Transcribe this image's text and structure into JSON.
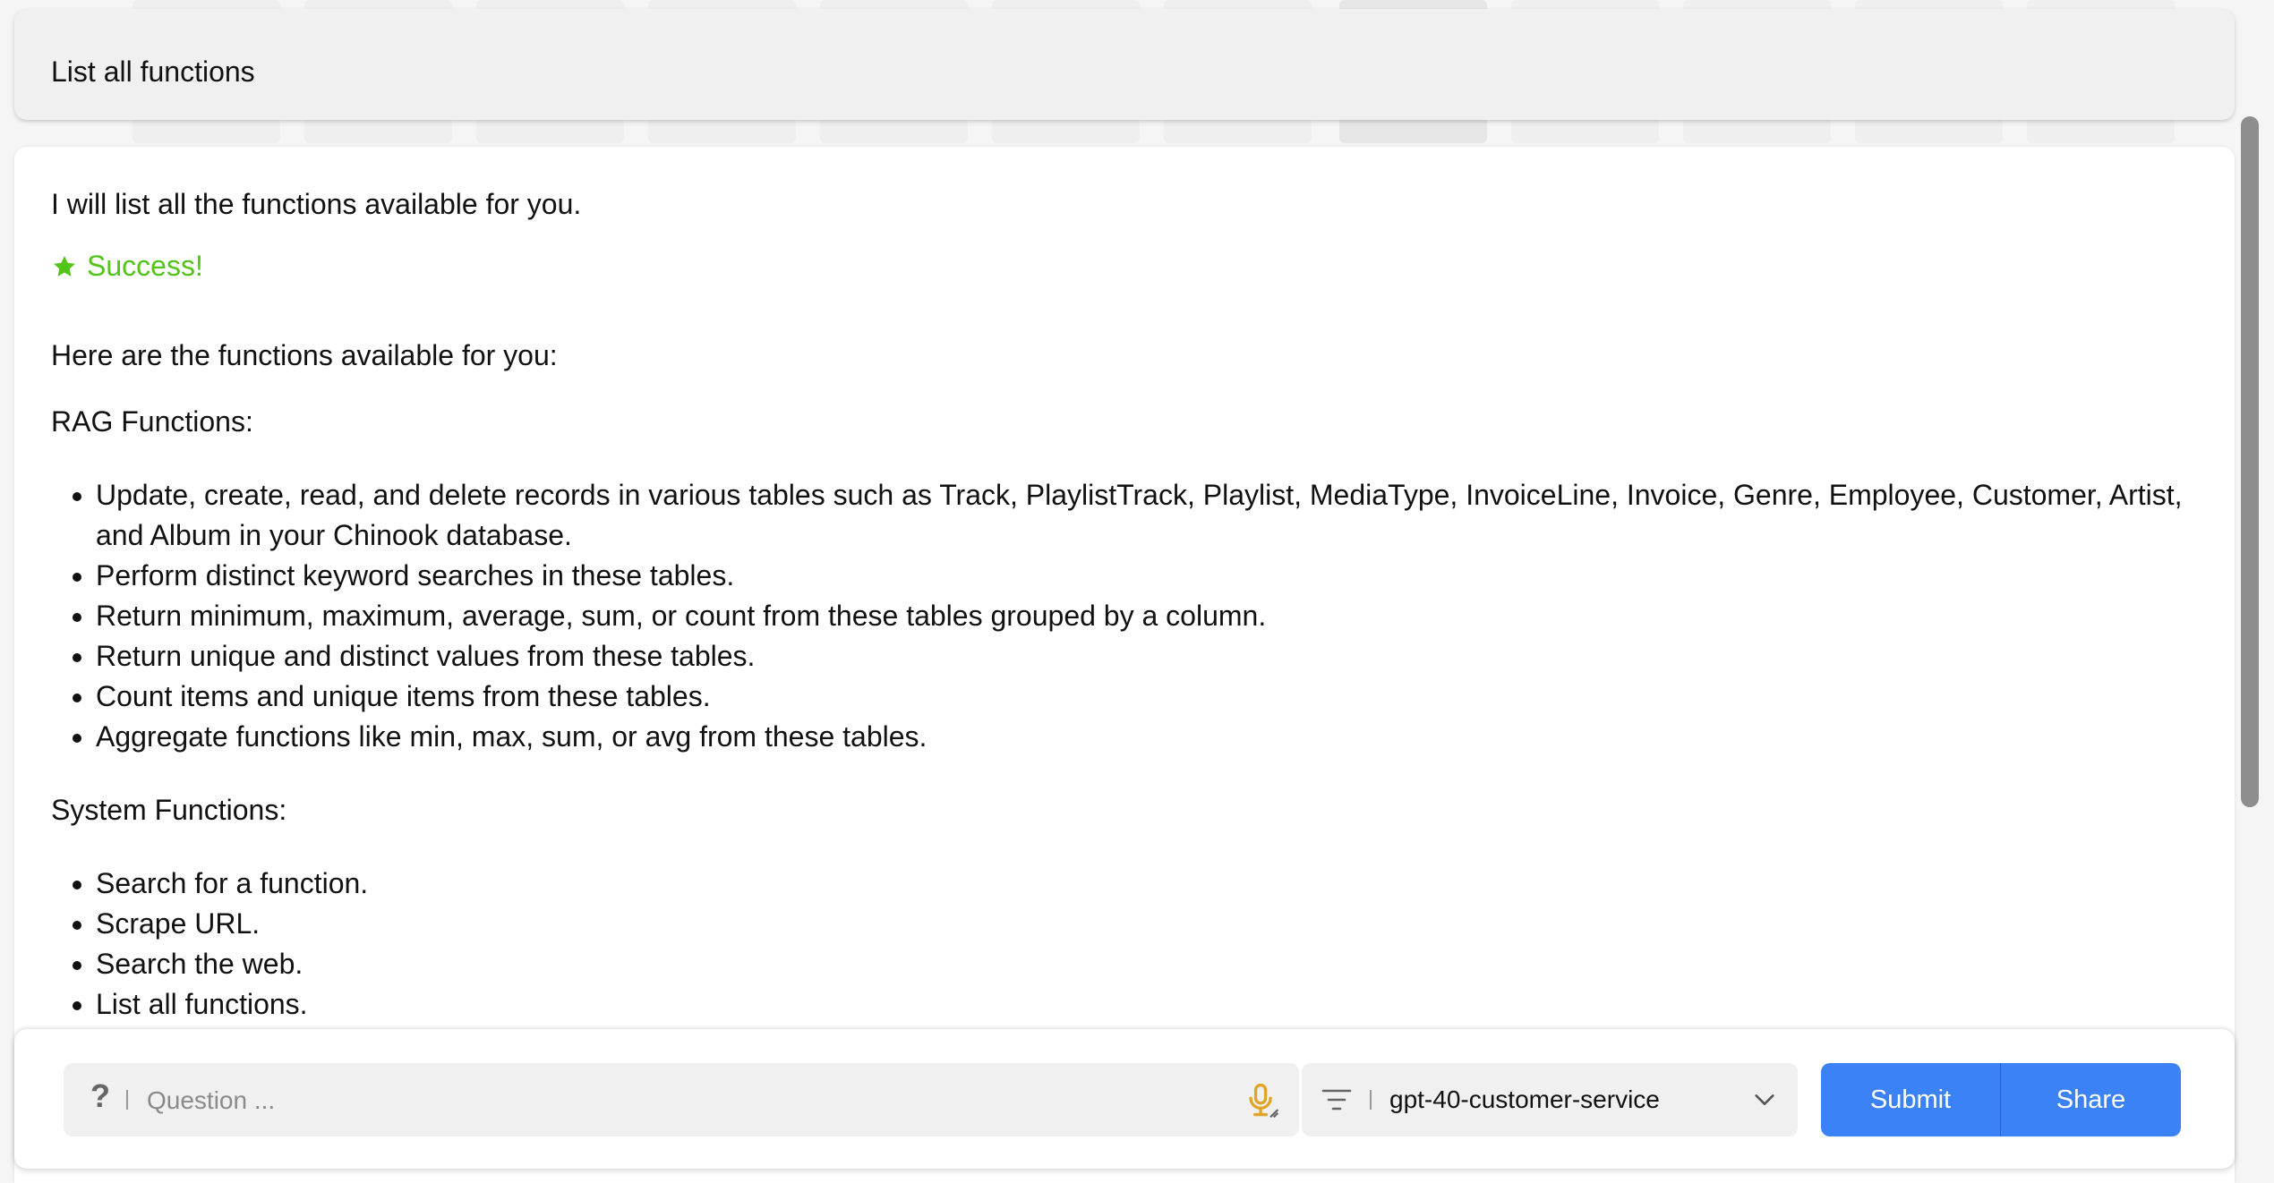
{
  "question": {
    "text": "List all functions"
  },
  "answer": {
    "intro": "I will list all the functions available for you.",
    "status": {
      "icon": "star-icon",
      "text": "Success!",
      "color": "#52c41a"
    },
    "heading": "Here are the functions available for you:",
    "rag_title": "RAG Functions:",
    "rag_items": [
      "Update, create, read, and delete records in various tables such as Track, PlaylistTrack, Playlist, MediaType, InvoiceLine, Invoice, Genre, Employee, Customer, Artist, and Album in your Chinook database.",
      "Perform distinct keyword searches in these tables.",
      "Return minimum, maximum, average, sum, or count from these tables grouped by a column.",
      "Return unique and distinct values from these tables.",
      "Count items and unique items from these tables.",
      "Aggregate functions like min, max, sum, or avg from these tables."
    ],
    "system_title": "System Functions:",
    "system_items": [
      "Search for a function.",
      "Scrape URL.",
      "Search the web.",
      "List all functions."
    ]
  },
  "input_bar": {
    "question_icon": "question-mark-icon",
    "question_placeholder": "Question ...",
    "mic_icon": "microphone-icon",
    "filter_icon": "filter-icon",
    "model_selected": "gpt-40-customer-service",
    "chevron_icon": "chevron-down-icon",
    "submit_label": "Submit",
    "share_label": "Share",
    "accent_color": "#3b82f6"
  }
}
